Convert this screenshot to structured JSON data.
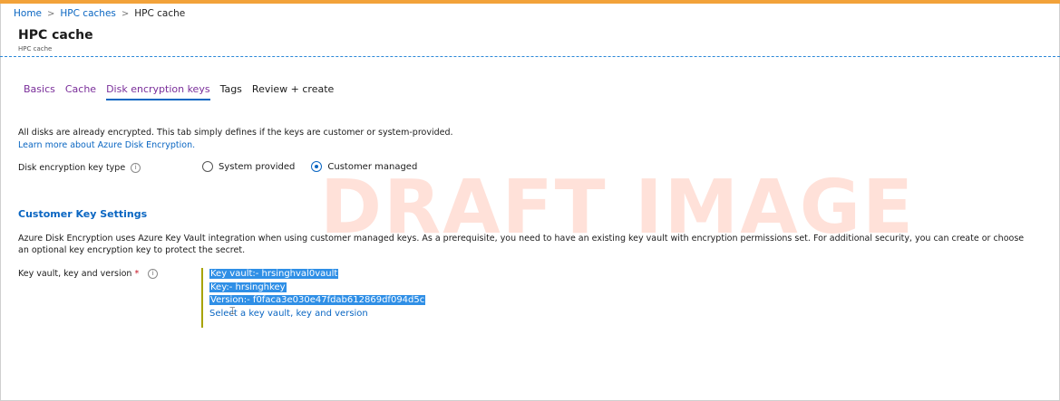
{
  "breadcrumb": {
    "home": "Home",
    "sep": ">",
    "caches": "HPC caches",
    "current": "HPC cache"
  },
  "header": {
    "title": "HPC cache",
    "subtitle": "HPC cache"
  },
  "tabs": [
    {
      "label": "Basics"
    },
    {
      "label": "Cache"
    },
    {
      "label": "Disk encryption keys"
    },
    {
      "label": "Tags"
    },
    {
      "label": "Review + create"
    }
  ],
  "intro": {
    "text": "All disks are already encrypted. This tab simply defines if the keys are customer or system-provided.",
    "link": "Learn more about Azure Disk Encryption."
  },
  "key_type": {
    "label": "Disk encryption key type",
    "info": "i",
    "options": [
      "System provided",
      "Customer managed"
    ],
    "selected": "Customer managed"
  },
  "customer_key": {
    "section_title": "Customer Key Settings",
    "description": "Azure Disk Encryption uses Azure Key Vault integration when using customer managed keys. As a prerequisite, you need to have an existing key vault with encryption permissions set. For additional security, you can create or choose an optional key encryption key to protect the secret.",
    "field_label": "Key vault, key and version",
    "required_mark": "*",
    "info": "i",
    "key_vault": "Key vault:- hrsinghval0vault",
    "key": "Key:- hrsinghkey",
    "version": "Version:- f0faca3e030e47fdab612869df094d5c",
    "select_link": "Select a key vault, key and version"
  },
  "watermark": "DRAFT IMAGE",
  "colors": {
    "accent": "#0a66c2",
    "visited": "#7a2e9a",
    "topbar": "#f2a23a",
    "selection": "#2f8fe6"
  }
}
